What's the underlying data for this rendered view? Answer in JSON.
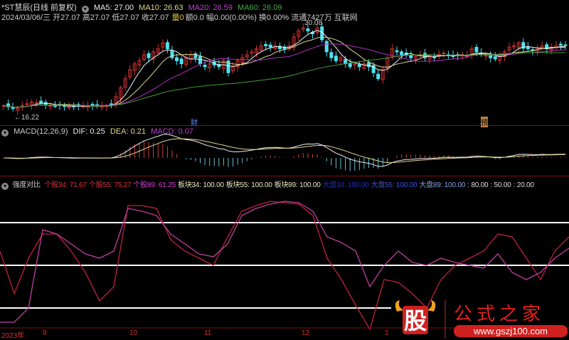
{
  "header": {
    "title": "*ST慧辰(日线 前复权)",
    "ma5": "MA5: 27.00",
    "ma10": "MA10: 26.63",
    "ma20": "MA20: 26.59",
    "ma60": "MA60: 26.09",
    "info": "2024/03/06/三 开27.07 高27.07 低27.07 收27.07",
    "vol": "量0",
    "info2": "额0.0 幅0.00(0.00%) 换0.00% 流通7427万 互联网"
  },
  "price_panel": {
    "high_label": "30.08",
    "low_label": "←16.22",
    "marker_cai": "财",
    "marker_yu": "预"
  },
  "macd": {
    "title": "MACD(12,26,9)",
    "dif": "DIF: 0.25",
    "dea": "DEA: 0.21",
    "macd": "MACD: 0.07"
  },
  "strength": {
    "title": "强度对比",
    "items": [
      {
        "text": "个股34: 71.67",
        "color": "#e0303a"
      },
      {
        "text": "个股55: 75.27",
        "color": "#e0303a"
      },
      {
        "text": "个股89: 61.25",
        "color": "#d040d0"
      },
      {
        "text": "板块34: 100.00",
        "color": "#e8e8c0"
      },
      {
        "text": "板块55: 100.00",
        "color": "#e8e8c0"
      },
      {
        "text": "板块89: 100.00",
        "color": "#e8e8c0"
      },
      {
        "text": "大盘34: 100.00",
        "color": "#2030c0"
      },
      {
        "text": "大盘55: 100.00",
        "color": "#4050e0"
      },
      {
        "text": "大盘89: 100.00",
        "color": "#80a0e0"
      },
      {
        "text": ": 80.00",
        "color": "#dddddd"
      },
      {
        "text": ": 50.00",
        "color": "#dddddd"
      },
      {
        "text": ": 20.00",
        "color": "#dddddd"
      }
    ]
  },
  "xaxis": [
    "2023年",
    "9",
    "10",
    "11",
    "12",
    "1"
  ],
  "watermark": {
    "text": "股 公式之家",
    "url": "www.gszj100.com"
  },
  "chart_data": {
    "type": "candlestick",
    "closes": [
      17,
      16.8,
      16.5,
      16.6,
      17,
      17.3,
      17.6,
      17.5,
      17.4,
      17.2,
      17,
      16.9,
      17,
      16.9,
      16.8,
      16.9,
      17,
      16.9,
      17,
      17,
      17,
      17,
      17,
      17.1,
      18.5,
      20,
      21.5,
      23,
      24,
      24.5,
      25.5,
      25,
      26,
      26.5,
      27.5,
      26.5,
      25,
      24.5,
      24,
      25,
      25.5,
      25,
      24,
      23.5,
      24,
      23.8,
      23.5,
      24.5,
      22.5,
      23.5,
      24.5,
      25,
      25.5,
      26,
      26.5,
      27,
      27,
      26.8,
      27,
      26.5,
      26.5,
      27,
      28.5,
      29.5,
      30,
      29.5,
      29,
      30,
      28,
      26,
      25,
      24.5,
      25,
      24,
      23.5,
      24,
      23.5,
      24,
      23.5,
      22.5,
      21.5,
      23,
      25,
      26.5,
      26,
      25.5,
      25.5,
      25,
      25.2,
      25.5,
      25,
      25.3,
      25,
      25.6,
      25.8,
      25.5,
      25.2,
      25.4,
      25.5,
      25.4,
      26.5,
      26,
      25.5,
      25.4,
      25,
      24.8,
      25.3,
      26,
      26.8,
      27,
      27.5,
      26.6,
      26.5,
      26.2,
      26.5,
      27,
      26.5,
      26.8,
      27,
      27.1,
      27.07
    ],
    "strength_ylim": [
      0,
      100
    ],
    "strength_lines": [
      {
        "name": "个股34",
        "color": "#c02040",
        "values": [
          60,
          30,
          55,
          72,
          72,
          60,
          45,
          25,
          35,
          92,
          92,
          90,
          68,
          60,
          55,
          50,
          70,
          88,
          92,
          95,
          94,
          93,
          85,
          55,
          40,
          22,
          5,
          40,
          38,
          30,
          20,
          40,
          50,
          55,
          60,
          72,
          70,
          55,
          40,
          60,
          70
        ]
      },
      {
        "name": "个股55",
        "color": "#c040a0",
        "values": [
          10,
          10,
          20,
          75,
          72,
          65,
          58,
          55,
          60,
          90,
          88,
          85,
          72,
          65,
          58,
          56,
          65,
          85,
          90,
          93,
          95,
          94,
          88,
          70,
          66,
          60,
          35,
          50,
          60,
          52,
          50,
          55,
          52,
          50,
          48,
          58,
          45,
          40,
          45,
          55,
          62
        ]
      }
    ],
    "levels": [
      80,
      50,
      20
    ]
  }
}
